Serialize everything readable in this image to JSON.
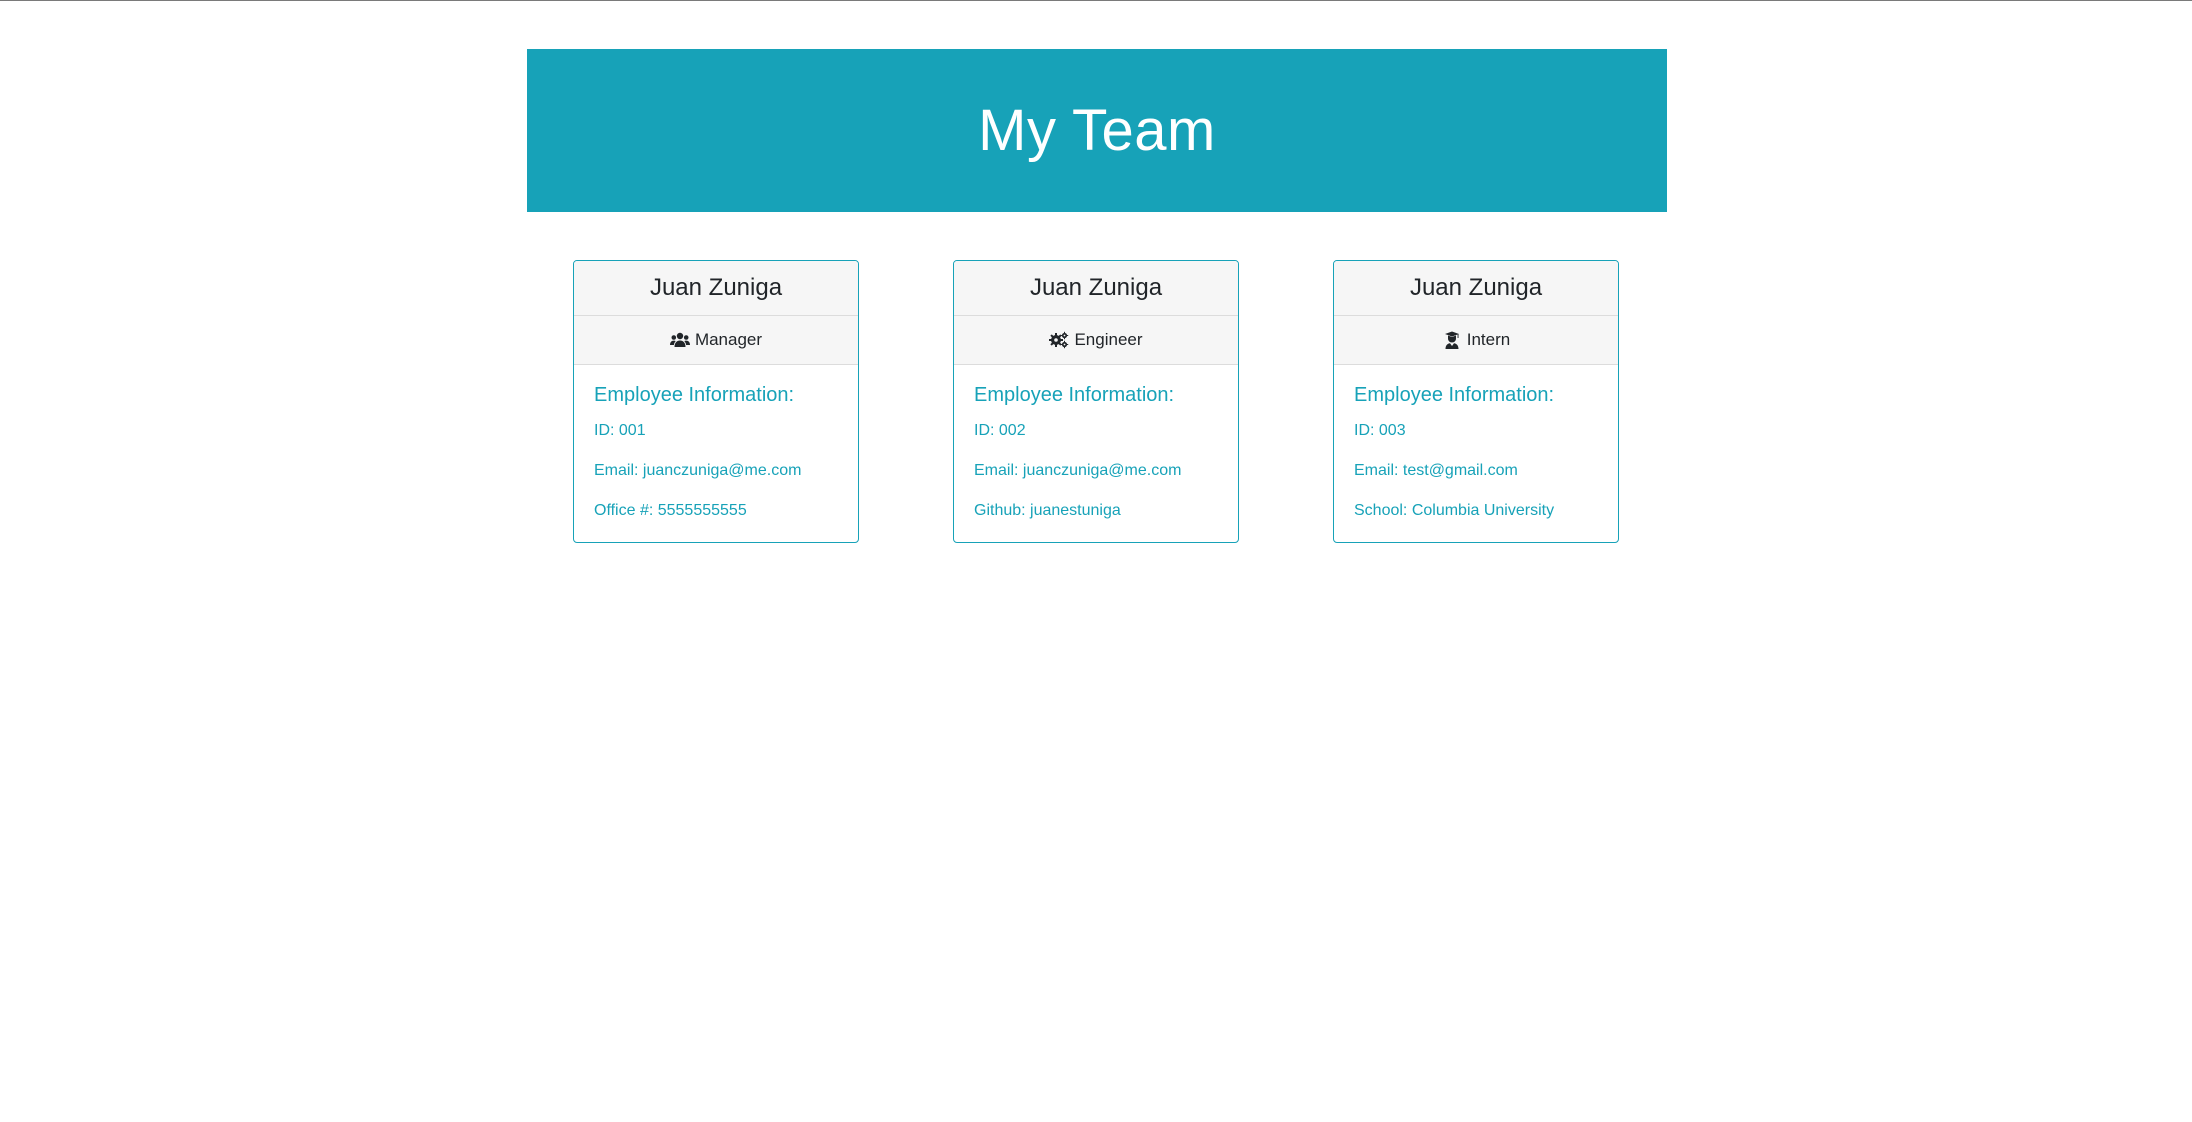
{
  "header": {
    "title": "My Team"
  },
  "cards": [
    {
      "name": "Juan Zuniga",
      "role": "Manager",
      "role_icon": "users-icon",
      "info_title": "Employee Information:",
      "id_text": "ID: 001",
      "email_text": "Email: juanczuniga@me.com",
      "extra_text": "Office #: 5555555555"
    },
    {
      "name": "Juan Zuniga",
      "role": "Engineer",
      "role_icon": "gears-icon",
      "info_title": "Employee Information:",
      "id_text": "ID: 002",
      "email_text": "Email: juanczuniga@me.com",
      "extra_text": "Github: juanestuniga"
    },
    {
      "name": "Juan Zuniga",
      "role": "Intern",
      "role_icon": "graduate-icon",
      "info_title": "Employee Information:",
      "id_text": "ID: 003",
      "email_text": "Email: test@gmail.com",
      "extra_text": "School: Columbia University"
    }
  ],
  "colors": {
    "accent": "#17a2b8",
    "card_header_bg": "#f6f6f6",
    "text_dark": "#212529"
  }
}
